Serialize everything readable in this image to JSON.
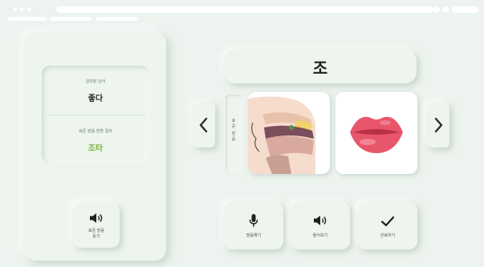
{
  "left_panel": {
    "input_word_label": "입력된 단어",
    "input_word": "좋다",
    "result_label": "표준 발음 변환 결과",
    "result_word": "조타",
    "listen_standard_label_line1": "표준 발음",
    "listen_standard_label_line2": "듣기"
  },
  "syllable": "조",
  "side_label_chars": [
    "표",
    "준",
    "발",
    "음"
  ],
  "actions": {
    "record_label": "발음해기",
    "listen_label": "들어보기",
    "complete_label": "완료하기"
  },
  "colors": {
    "background": "#edf3ee",
    "result_text": "#7bb33a",
    "lips": "#e8566b"
  },
  "icons": {
    "prev": "chevron-left-icon",
    "next": "chevron-right-icon",
    "speaker": "speaker-icon",
    "mic": "microphone-icon",
    "check": "check-icon"
  }
}
